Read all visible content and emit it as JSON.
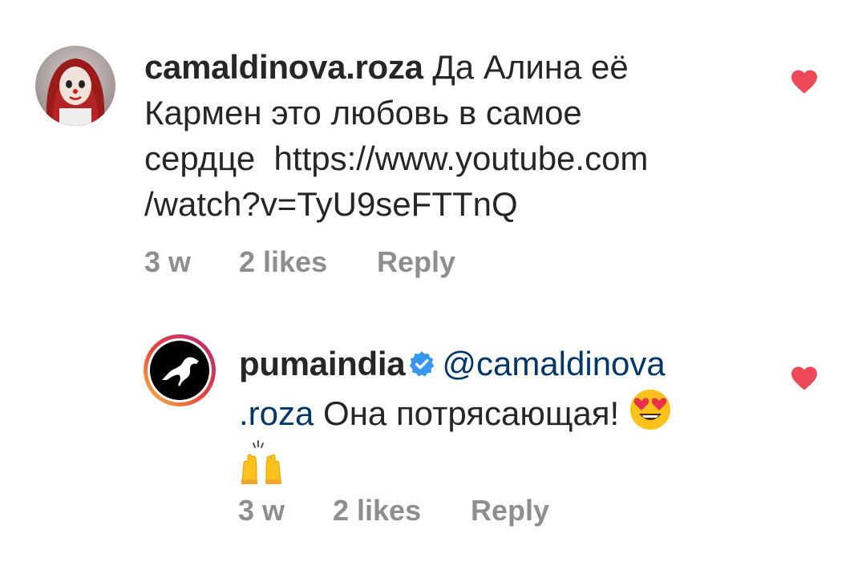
{
  "comments": [
    {
      "username": "camaldinova.roza",
      "text_line1": "Да Алина её",
      "text_line2": "Кармен это любовь в самое",
      "text_line3": "сердце  https://www.youtube.com",
      "text_line4": "/watch?v=TyU9seFTTnQ",
      "time": "3 w",
      "likes": "2 likes",
      "reply": "Reply",
      "liked": true
    },
    {
      "username": "pumaindia",
      "verified": true,
      "mention_part1": "@camaldinova",
      "mention_part2": ".roza",
      "text": "Она потрясающая!",
      "emoji_1": "heart-eyes-emoji",
      "emoji_2": "raising-hands-emoji",
      "time": "3 w",
      "likes": "2 likes",
      "reply": "Reply",
      "liked": true
    }
  ],
  "colors": {
    "text": "#262626",
    "secondary": "#8e8e8e",
    "mention": "#00376b",
    "heart": "#ed4956",
    "verified": "#3897f0"
  }
}
